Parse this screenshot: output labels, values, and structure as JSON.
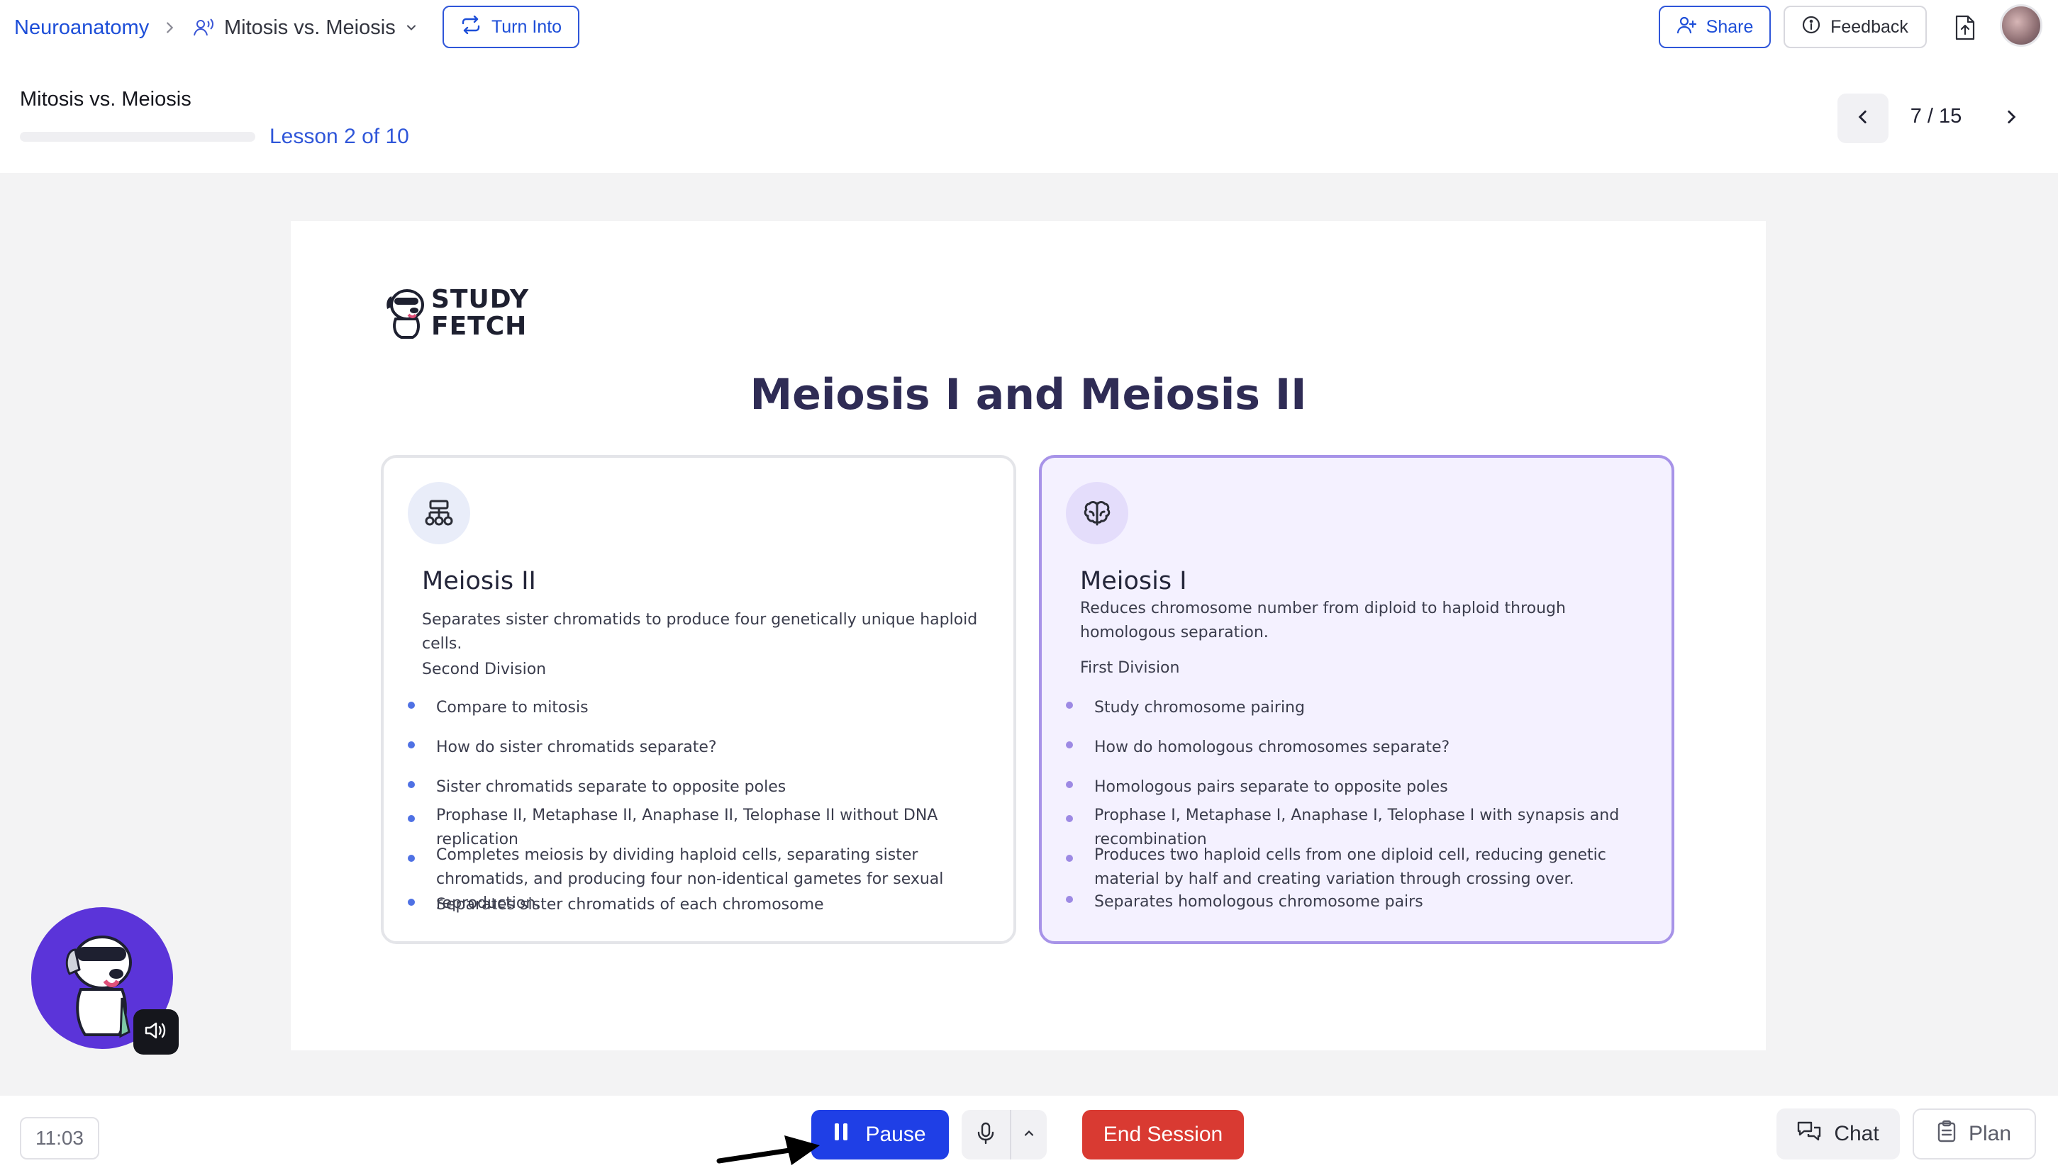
{
  "header": {
    "breadcrumb_root": "Neuroanatomy",
    "breadcrumb_current": "Mitosis vs. Meiosis",
    "turn_into_label": "Turn Into",
    "share_label": "Share",
    "feedback_label": "Feedback"
  },
  "lesson": {
    "title": "Mitosis vs. Meiosis",
    "progress_fraction": 0.0,
    "counter": "Lesson 2 of 10",
    "page": "7 / 15"
  },
  "slide": {
    "logo_line1": "STUDY",
    "logo_line2": "FETCH",
    "title": "Meiosis I and Meiosis II",
    "cards": [
      {
        "icon": "hierarchy-icon",
        "title": "Meiosis II",
        "description": "Separates sister chromatids to produce four genetically unique haploid cells.",
        "subtitle": "Second Division",
        "bullets": [
          "Compare to mitosis",
          "How do sister chromatids separate?",
          "Sister chromatids separate to opposite poles",
          "Prophase II, Metaphase II, Anaphase II, Telophase II without DNA replication",
          "Completes meiosis by dividing haploid cells, separating sister chromatids, and producing four non-identical gametes for sexual reproduction.",
          "Separates sister chromatids of each chromosome"
        ]
      },
      {
        "icon": "brain-icon",
        "title": "Meiosis I",
        "description": "Reduces chromosome number from diploid to haploid through homologous separation.",
        "subtitle": "First Division",
        "bullets": [
          "Study chromosome pairing",
          "How do homologous chromosomes separate?",
          "Homologous pairs separate to opposite poles",
          "Prophase I, Metaphase I, Anaphase I, Telophase I with synapsis and recombination",
          "Produces two haploid cells from one diploid cell, reducing genetic material by half and creating variation through crossing over.",
          "Separates homologous chromosome pairs"
        ]
      }
    ]
  },
  "controls": {
    "timer": "11:03",
    "pause_label": "Pause",
    "end_session_label": "End Session",
    "chat_label": "Chat",
    "plan_label": "Plan"
  },
  "colors": {
    "primary_blue": "#1f3fe6",
    "end_red": "#d93a32",
    "accent_purple": "#a793e8",
    "mascot_bg": "#5b34d9"
  }
}
